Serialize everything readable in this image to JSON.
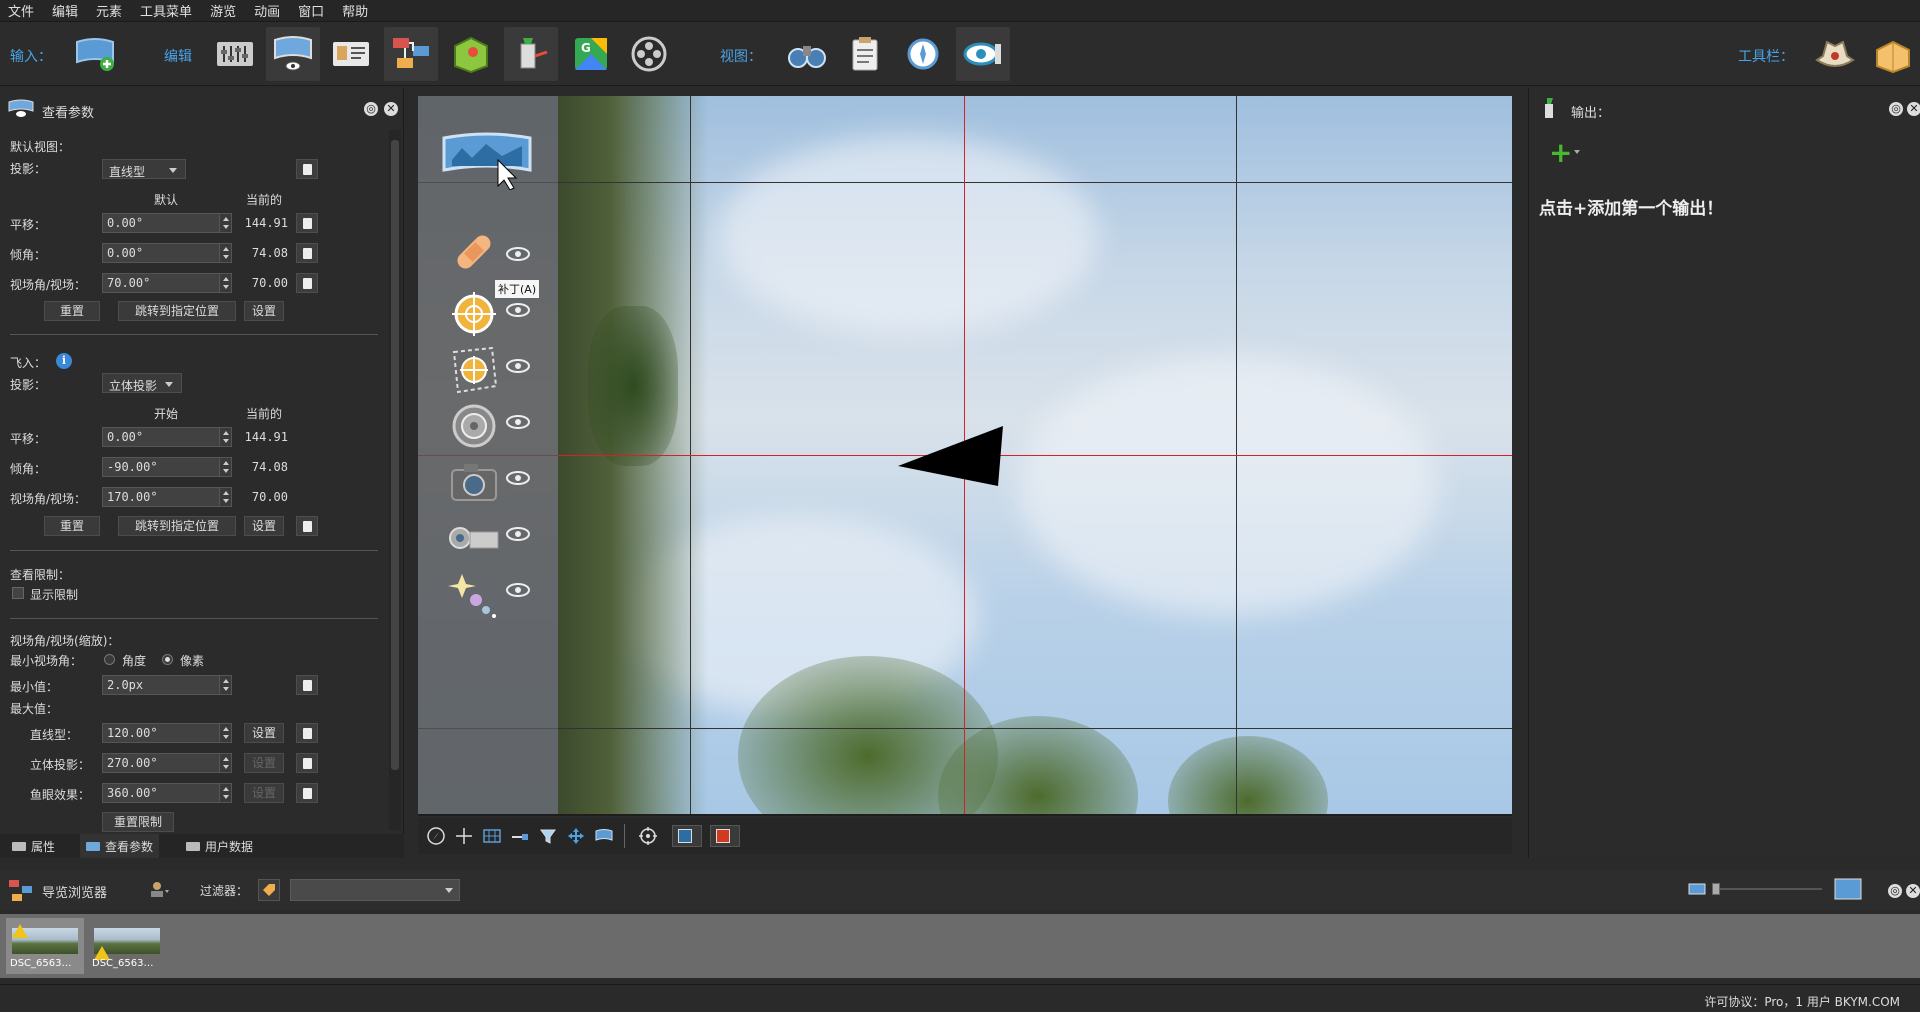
{
  "menu": [
    "文件",
    "编辑",
    "元素",
    "工具菜单",
    "游览",
    "动画",
    "窗口",
    "帮助"
  ],
  "toolbar": {
    "input_label": "输入：",
    "edit_label": "编辑",
    "view_label": "视图：",
    "toolbar_label": "工具栏："
  },
  "left_panel": {
    "title": "查看参数",
    "default_view": {
      "heading": "默认视图：",
      "projection_label": "投影：",
      "projection_value": "直线型",
      "col_default": "默认",
      "col_current": "当前的",
      "pan_label": "平移：",
      "pan_value": "0.00°",
      "pan_current": "144.91",
      "tilt_label": "倾角：",
      "tilt_value": "0.00°",
      "tilt_current": "74.08",
      "fov_label": "视场角/视场：",
      "fov_value": "70.00°",
      "fov_current": "70.00",
      "reset": "重置",
      "goto": "跳转到指定位置",
      "set": "设置"
    },
    "fly_in": {
      "heading": "飞入：",
      "projection_label": "投影：",
      "projection_value": "立体投影",
      "col_start": "开始",
      "col_current": "当前的",
      "pan_label": "平移：",
      "pan_value": "0.00°",
      "pan_current": "144.91",
      "tilt_label": "倾角：",
      "tilt_value": "-90.00°",
      "tilt_current": "74.08",
      "fov_label": "视场角/视场：",
      "fov_value": "170.00°",
      "fov_current": "70.00",
      "reset": "重置",
      "goto": "跳转到指定位置",
      "set": "设置"
    },
    "limits": {
      "heading": "查看限制：",
      "show_limits": "显示限制"
    },
    "zoom": {
      "heading": "视场角/视场(缩放)：",
      "min_fov_label": "最小视场角：",
      "opt_angle": "角度",
      "opt_pixel": "像素",
      "min_label": "最小值：",
      "min_value": "2.0px",
      "max_label": "最大值：",
      "rect_label": "直线型：",
      "rect_value": "120.00°",
      "stereo_label": "立体投影：",
      "stereo_value": "270.00°",
      "fisheye_label": "鱼眼效果：",
      "fisheye_value": "360.00°",
      "set": "设置",
      "reset_limits": "重置限制"
    },
    "tabs": [
      "属性",
      "查看参数",
      "用户数据"
    ]
  },
  "viewport": {
    "tooltip": "补丁(A)"
  },
  "right_panel": {
    "title": "输出：",
    "plus": "+",
    "message": "点击+添加第一个输出！"
  },
  "browser": {
    "title": "导览浏览器",
    "filter_label": "过滤器：",
    "thumbs": [
      {
        "name": "DSC_6563…"
      },
      {
        "name": "DSC_6563…"
      }
    ]
  },
  "status": {
    "text": "许可协议：Pro，1 用户 BKYM.COM"
  },
  "colors": {
    "accent": "#4aa3e8",
    "crosshair": "#d8202a",
    "add_green": "#48b82c"
  }
}
